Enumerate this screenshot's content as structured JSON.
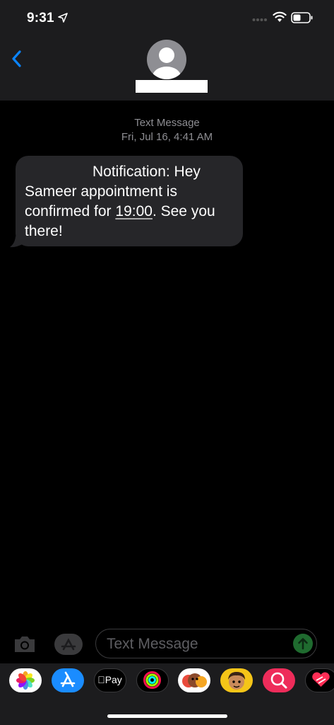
{
  "status_bar": {
    "time": "9:31",
    "icons": [
      "location-icon",
      "signal-dots",
      "wifi-icon",
      "battery-icon"
    ]
  },
  "header": {
    "back_icon": "chevron-left-icon",
    "avatar_icon": "person-silhouette-icon",
    "contact_name_redacted": true
  },
  "conversation": {
    "service_label": "Text Message",
    "date": "Fri, Jul 16, 4:41 AM",
    "messages": [
      {
        "sender_redacted": true,
        "text_before": "Notification: Hey Sameer appointment is confirmed for ",
        "time_link": "19:00",
        "text_after": ". See you there!"
      }
    ]
  },
  "input_bar": {
    "camera_icon": "camera-icon",
    "apps_icon": "app-store-icon",
    "placeholder": "Text Message",
    "send_icon": "send-arrow-icon"
  },
  "app_drawer": {
    "apps": [
      {
        "name": "photos-icon"
      },
      {
        "name": "app-store-icon"
      },
      {
        "name": "apple-pay-icon",
        "label": "Pay"
      },
      {
        "name": "activity-rings-icon"
      },
      {
        "name": "animoji-icon"
      },
      {
        "name": "memoji-icon"
      },
      {
        "name": "search-images-icon"
      },
      {
        "name": "digital-touch-icon"
      }
    ]
  },
  "colors": {
    "background": "#000000",
    "header": "#1c1c1e",
    "bubble": "#262629",
    "meta_text": "#8e8e93",
    "accent_blue": "#0a84ff",
    "send_green": "#1f6b2f"
  }
}
